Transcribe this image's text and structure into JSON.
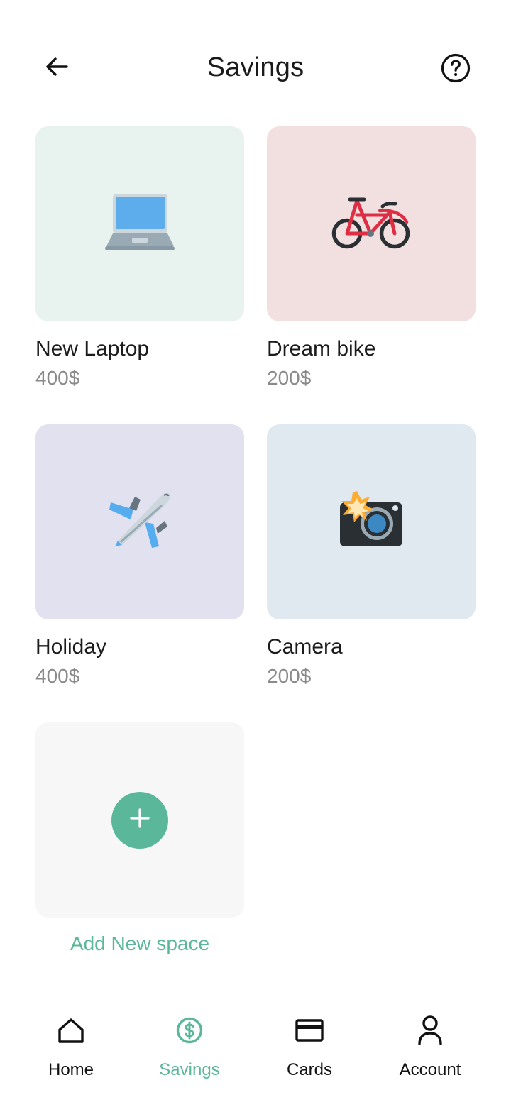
{
  "header": {
    "title": "Savings",
    "back_icon": "arrow-left-icon",
    "help_icon": "help-circle-icon"
  },
  "savings": [
    {
      "name": "New Laptop",
      "amount": "400$",
      "icon": "laptop-icon",
      "bg": "#e8f2ee"
    },
    {
      "name": "Dream bike",
      "amount": "200$",
      "icon": "bicycle-icon",
      "bg": "#f2dfdf"
    },
    {
      "name": "Holiday",
      "amount": "400$",
      "icon": "airplane-icon",
      "bg": "#e1e1ef"
    },
    {
      "name": "Camera",
      "amount": "200$",
      "icon": "camera-flash-icon",
      "bg": "#e0e9ef"
    }
  ],
  "add_space": {
    "label": "Add New space",
    "icon": "plus-icon",
    "bg": "#f7f7f7"
  },
  "nav": {
    "items": [
      {
        "label": "Home",
        "icon": "home-icon",
        "active": false
      },
      {
        "label": "Savings",
        "icon": "dollar-circle-icon",
        "active": true
      },
      {
        "label": "Cards",
        "icon": "credit-card-icon",
        "active": false
      },
      {
        "label": "Account",
        "icon": "user-icon",
        "active": false
      }
    ]
  },
  "colors": {
    "accent": "#5bb79a",
    "text": "#1a1a1a",
    "muted": "#8a8a8a"
  }
}
